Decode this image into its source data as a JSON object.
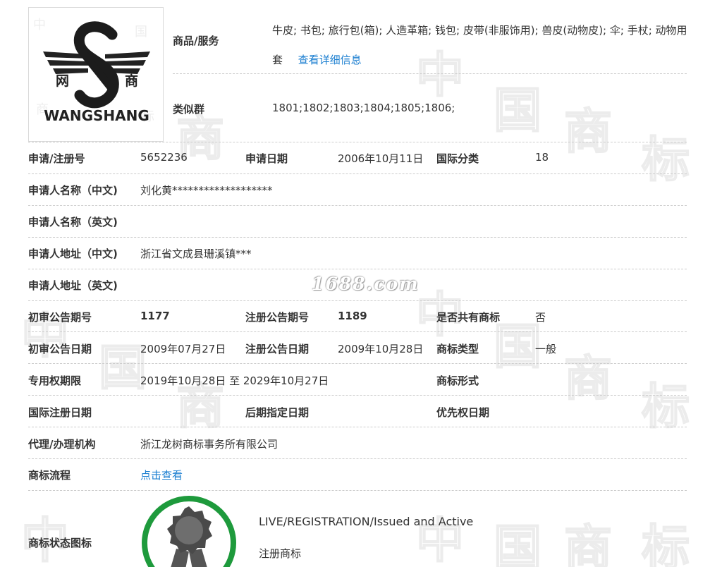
{
  "logo": {
    "wordmark": "WANGSHANG",
    "char_left": "网",
    "char_right": "商"
  },
  "goods": {
    "label": "商品/服务",
    "text": "牛皮; 书包; 旅行包(箱); 人造革箱; 钱包; 皮带(非服饰用); 兽皮(动物皮); 伞; 手杖; 动物用套",
    "more_link": "查看详细信息"
  },
  "similar_group": {
    "label": "类似群",
    "value": "1801;1802;1803;1804;1805;1806;"
  },
  "rows": {
    "reg_no": {
      "label": "申请/注册号",
      "value": "5652236"
    },
    "apply_date": {
      "label": "申请日期",
      "value": "2006年10月11日"
    },
    "intl_class": {
      "label": "国际分类",
      "value": "18"
    },
    "applicant_cn": {
      "label": "申请人名称（中文)",
      "value": "刘化黄*******************"
    },
    "applicant_en": {
      "label": "申请人名称（英文)",
      "value": ""
    },
    "address_cn": {
      "label": "申请人地址（中文)",
      "value": "浙江省文成县珊溪镇***"
    },
    "address_en": {
      "label": "申请人地址（英文)",
      "value": ""
    },
    "prelim_issue": {
      "label": "初审公告期号",
      "value": "1177"
    },
    "reg_issue": {
      "label": "注册公告期号",
      "value": "1189"
    },
    "shared": {
      "label": "是否共有商标",
      "value": "否"
    },
    "prelim_date": {
      "label": "初审公告日期",
      "value": "2009年07月27日"
    },
    "reg_date": {
      "label": "注册公告日期",
      "value": "2009年10月28日"
    },
    "tm_type": {
      "label": "商标类型",
      "value": "一般"
    },
    "exclusive_period": {
      "label": "专用权期限",
      "value": "2019年10月28日 至 2029年10月27日"
    },
    "tm_form": {
      "label": "商标形式",
      "value": ""
    },
    "intl_reg_date": {
      "label": "国际注册日期",
      "value": ""
    },
    "later_designation": {
      "label": "后期指定日期",
      "value": ""
    },
    "priority_date": {
      "label": "优先权日期",
      "value": ""
    },
    "agent": {
      "label": "代理/办理机构",
      "value": "浙江龙树商标事务所有限公司"
    },
    "process": {
      "label": "商标流程",
      "link": "点击查看"
    }
  },
  "status": {
    "label": "商标状态图标",
    "en": "LIVE/REGISTRATION/Issued and Active",
    "cn": "注册商标"
  },
  "watermarks": {
    "site": "1688.com",
    "chars": [
      "中",
      "国",
      "商",
      "标"
    ]
  },
  "colors": {
    "link": "#1a7ed0",
    "status_ring": "#1e9a3c",
    "divider": "#cccccc"
  }
}
